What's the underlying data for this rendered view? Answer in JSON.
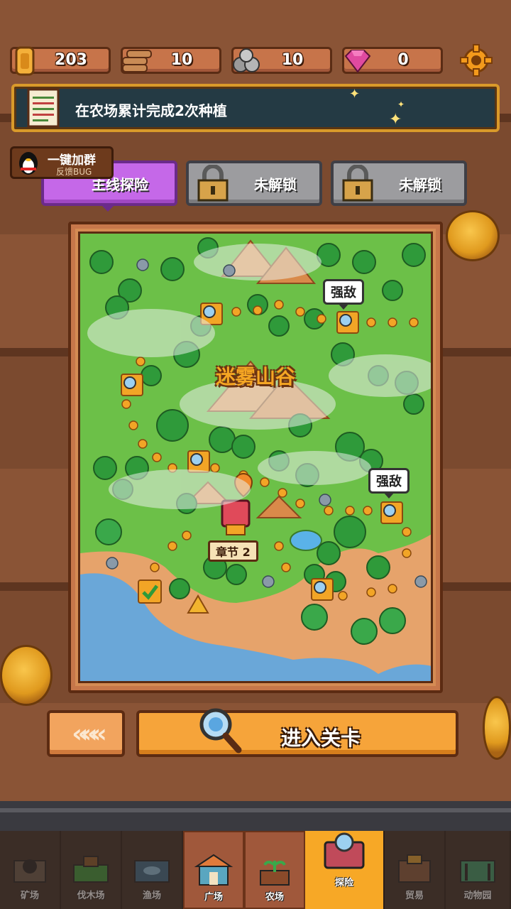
{
  "resources": {
    "coins": "203",
    "wood": "10",
    "stone": "10",
    "gems": "0"
  },
  "quest": {
    "text": "在农场累计完成2次种植"
  },
  "qq_group": {
    "title": "一键加群",
    "subtitle": "反馈BUG"
  },
  "tabs": [
    {
      "label": "主线探险"
    },
    {
      "label": "未解锁"
    },
    {
      "label": "未解锁"
    }
  ],
  "map": {
    "title": "迷雾山谷",
    "enemy_label_1": "强敌",
    "enemy_label_2": "强敌",
    "chapter_label": "章节 2"
  },
  "actions": {
    "back_label": "«««",
    "enter_label": "进入关卡"
  },
  "nav": {
    "items": [
      {
        "label": "矿场"
      },
      {
        "label": "伐木场"
      },
      {
        "label": "渔场"
      },
      {
        "label": "广场"
      },
      {
        "label": "农场"
      },
      {
        "label": "探险"
      },
      {
        "label": "贸易"
      },
      {
        "label": "动物园"
      }
    ]
  },
  "colors": {
    "active_tab": "#c568e8",
    "enter_button": "#f6a43a",
    "quest_border": "#d99a2a",
    "map_title": "#f5a623"
  }
}
